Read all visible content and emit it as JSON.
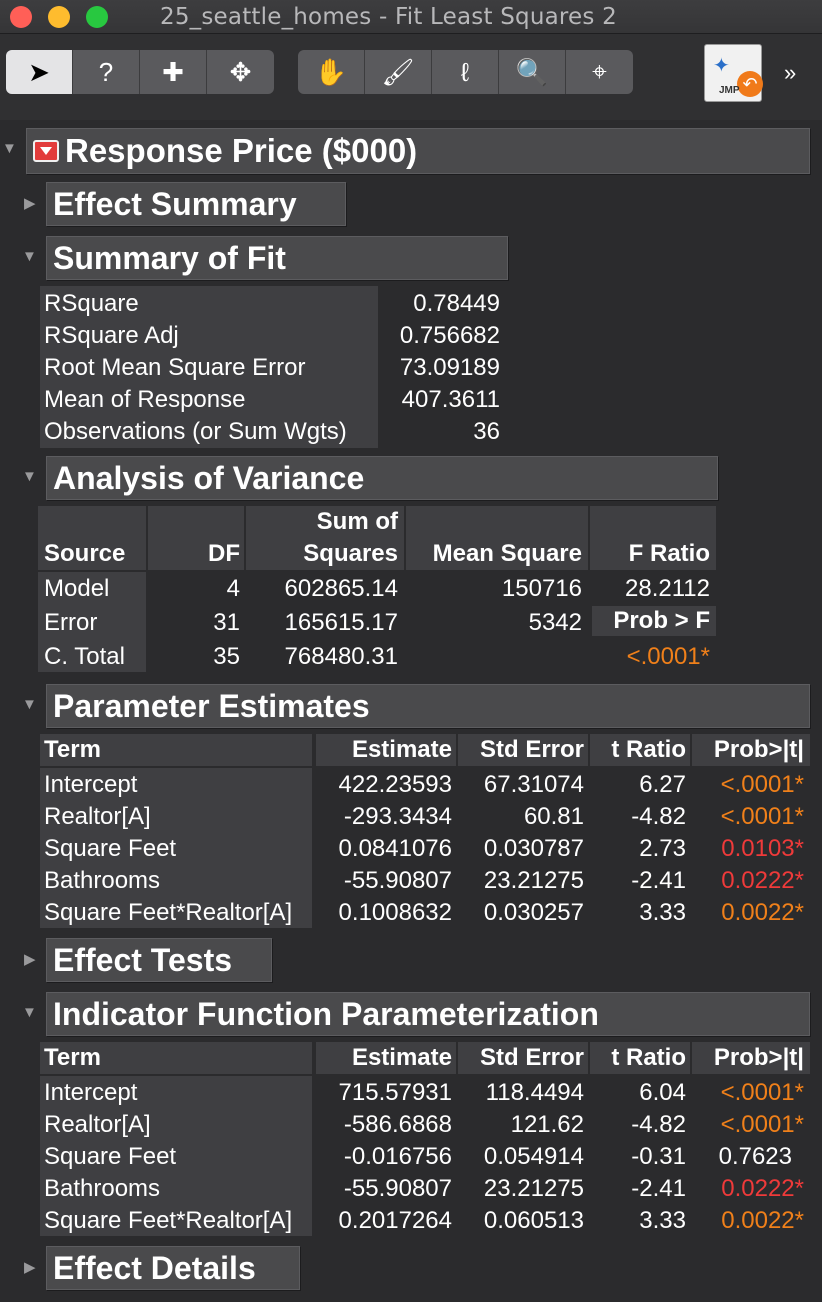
{
  "window": {
    "title": "25_seattle_homes - Fit Least Squares 2"
  },
  "toolbar": {
    "tools": [
      {
        "name": "arrow-tool-icon",
        "glyph": "➤"
      },
      {
        "name": "help-tool-icon",
        "glyph": "?"
      },
      {
        "name": "selection-tool-icon",
        "glyph": "✚"
      },
      {
        "name": "move-tool-icon",
        "glyph": "✥"
      },
      {
        "name": "grabber-hand-icon",
        "glyph": "✋"
      },
      {
        "name": "brush-tool-icon",
        "glyph": "🖌"
      },
      {
        "name": "lasso-tool-icon",
        "glyph": "ℓ"
      },
      {
        "name": "magnifier-icon",
        "glyph": "🔍"
      },
      {
        "name": "crosshair-tool-icon",
        "glyph": "⌖"
      }
    ],
    "jmp_label": "JMP",
    "more": "»"
  },
  "report": {
    "response_title": "Response Price ($000)",
    "effect_summary": "Effect Summary",
    "summary_of_fit": {
      "title": "Summary of Fit",
      "rows": [
        {
          "label": "RSquare",
          "value": "0.78449"
        },
        {
          "label": "RSquare Adj",
          "value": "0.756682"
        },
        {
          "label": "Root Mean Square Error",
          "value": "73.09189"
        },
        {
          "label": "Mean of Response",
          "value": "407.3611"
        },
        {
          "label": "Observations (or Sum Wgts)",
          "value": "36"
        }
      ]
    },
    "anova": {
      "title": "Analysis of Variance",
      "headers": {
        "source": "Source",
        "df": "DF",
        "ss1": "Sum of",
        "ss2": "Squares",
        "ms": "Mean Square",
        "f": "F Ratio"
      },
      "rows": [
        {
          "source": "Model",
          "df": "4",
          "ss": "602865.14",
          "ms": "150716",
          "f": "28.2112"
        },
        {
          "source": "Error",
          "df": "31",
          "ss": "165615.17",
          "ms": "5342",
          "f": "Prob > F"
        },
        {
          "source": "C. Total",
          "df": "35",
          "ss": "768480.31",
          "ms": "",
          "f": "<.0001*"
        }
      ]
    },
    "parameter_estimates": {
      "title": "Parameter Estimates",
      "headers": {
        "term": "Term",
        "est": "Estimate",
        "se": "Std Error",
        "t": "t Ratio",
        "p": "Prob>|t|"
      },
      "rows": [
        {
          "term": "Intercept",
          "est": "422.23593",
          "se": "67.31074",
          "t": "6.27",
          "p": "<.0001*"
        },
        {
          "term": "Realtor[A]",
          "est": "-293.3434",
          "se": "60.81",
          "t": "-4.82",
          "p": "<.0001*"
        },
        {
          "term": "Square Feet",
          "est": "0.0841076",
          "se": "0.030787",
          "t": "2.73",
          "p": "0.0103*"
        },
        {
          "term": "Bathrooms",
          "est": "-55.90807",
          "se": "23.21275",
          "t": "-2.41",
          "p": "0.0222*"
        },
        {
          "term": "Square Feet*Realtor[A]",
          "est": "0.1008632",
          "se": "0.030257",
          "t": "3.33",
          "p": "0.0022*"
        }
      ]
    },
    "effect_tests": "Effect Tests",
    "indicator": {
      "title": "Indicator Function Parameterization",
      "headers": {
        "term": "Term",
        "est": "Estimate",
        "se": "Std Error",
        "t": "t Ratio",
        "p": "Prob>|t|"
      },
      "rows": [
        {
          "term": "Intercept",
          "est": "715.57931",
          "se": "118.4494",
          "t": "6.04",
          "p": "<.0001*"
        },
        {
          "term": "Realtor[A]",
          "est": "-586.6868",
          "se": "121.62",
          "t": "-4.82",
          "p": "<.0001*"
        },
        {
          "term": "Square Feet",
          "est": "-0.016756",
          "se": "0.054914",
          "t": "-0.31",
          "p": "0.7623"
        },
        {
          "term": "Bathrooms",
          "est": "-55.90807",
          "se": "23.21275",
          "t": "-2.41",
          "p": "0.0222*"
        },
        {
          "term": "Square Feet*Realtor[A]",
          "est": "0.2017264",
          "se": "0.060513",
          "t": "3.33",
          "p": "0.0022*"
        }
      ]
    },
    "effect_details": "Effect Details"
  },
  "colors": {
    "orange": "#f0801a",
    "red": "#ef3a3a",
    "background": "#2b2b2d",
    "header": "#4a4a4c"
  }
}
